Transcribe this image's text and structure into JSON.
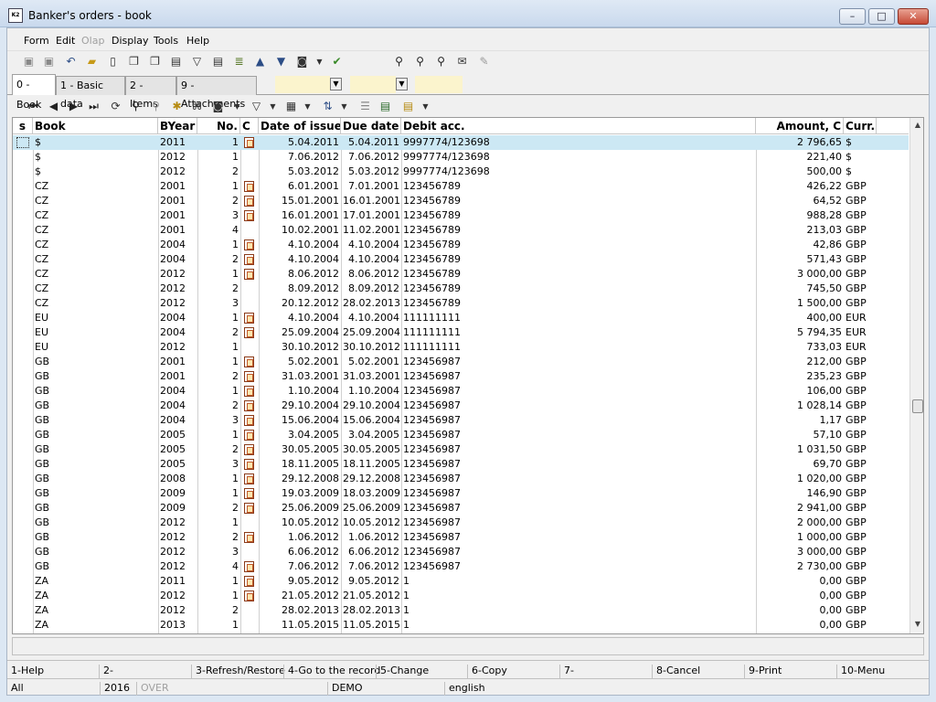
{
  "window": {
    "title": "Banker's orders - book",
    "app_badge": "K2",
    "minimize": "–",
    "maximize": "□",
    "close": "✕"
  },
  "menu": [
    "Form",
    "Edit",
    "Olap",
    "Display",
    "Tools",
    "Help"
  ],
  "tabs": [
    "0 - Book",
    "1 - Basic data",
    "2 - Items",
    "9 - Attachments"
  ],
  "columns": {
    "s": "s",
    "book": "Book",
    "byear": "BYear",
    "no": "No.",
    "c": "C",
    "issue": "Date of issue",
    "due": "Due date",
    "debit": "Debit acc.",
    "amount": "Amount, C",
    "curr": "Curr."
  },
  "rows": [
    {
      "book": "$",
      "byear": "2011",
      "no": "1",
      "c": true,
      "issue": "5.04.2011",
      "due": "5.04.2011",
      "debit": "9997774/123698",
      "amount": "2 796,65",
      "curr": "$"
    },
    {
      "book": "$",
      "byear": "2012",
      "no": "1",
      "c": false,
      "issue": "7.06.2012",
      "due": "7.06.2012",
      "debit": "9997774/123698",
      "amount": "221,40",
      "curr": "$"
    },
    {
      "book": "$",
      "byear": "2012",
      "no": "2",
      "c": false,
      "issue": "5.03.2012",
      "due": "5.03.2012",
      "debit": "9997774/123698",
      "amount": "500,00",
      "curr": "$"
    },
    {
      "book": "CZ",
      "byear": "2001",
      "no": "1",
      "c": true,
      "issue": "6.01.2001",
      "due": "7.01.2001",
      "debit": "123456789",
      "amount": "426,22",
      "curr": "GBP"
    },
    {
      "book": "CZ",
      "byear": "2001",
      "no": "2",
      "c": true,
      "issue": "15.01.2001",
      "due": "16.01.2001",
      "debit": "123456789",
      "amount": "64,52",
      "curr": "GBP"
    },
    {
      "book": "CZ",
      "byear": "2001",
      "no": "3",
      "c": true,
      "issue": "16.01.2001",
      "due": "17.01.2001",
      "debit": "123456789",
      "amount": "988,28",
      "curr": "GBP"
    },
    {
      "book": "CZ",
      "byear": "2001",
      "no": "4",
      "c": false,
      "issue": "10.02.2001",
      "due": "11.02.2001",
      "debit": "123456789",
      "amount": "213,03",
      "curr": "GBP"
    },
    {
      "book": "CZ",
      "byear": "2004",
      "no": "1",
      "c": true,
      "issue": "4.10.2004",
      "due": "4.10.2004",
      "debit": "123456789",
      "amount": "42,86",
      "curr": "GBP"
    },
    {
      "book": "CZ",
      "byear": "2004",
      "no": "2",
      "c": true,
      "issue": "4.10.2004",
      "due": "4.10.2004",
      "debit": "123456789",
      "amount": "571,43",
      "curr": "GBP"
    },
    {
      "book": "CZ",
      "byear": "2012",
      "no": "1",
      "c": true,
      "issue": "8.06.2012",
      "due": "8.06.2012",
      "debit": "123456789",
      "amount": "3 000,00",
      "curr": "GBP"
    },
    {
      "book": "CZ",
      "byear": "2012",
      "no": "2",
      "c": false,
      "issue": "8.09.2012",
      "due": "8.09.2012",
      "debit": "123456789",
      "amount": "745,50",
      "curr": "GBP"
    },
    {
      "book": "CZ",
      "byear": "2012",
      "no": "3",
      "c": false,
      "issue": "20.12.2012",
      "due": "28.02.2013",
      "debit": "123456789",
      "amount": "1 500,00",
      "curr": "GBP"
    },
    {
      "book": "EU",
      "byear": "2004",
      "no": "1",
      "c": true,
      "issue": "4.10.2004",
      "due": "4.10.2004",
      "debit": "111111111",
      "amount": "400,00",
      "curr": "EUR"
    },
    {
      "book": "EU",
      "byear": "2004",
      "no": "2",
      "c": true,
      "issue": "25.09.2004",
      "due": "25.09.2004",
      "debit": "111111111",
      "amount": "5 794,35",
      "curr": "EUR"
    },
    {
      "book": "EU",
      "byear": "2012",
      "no": "1",
      "c": false,
      "issue": "30.10.2012",
      "due": "30.10.2012",
      "debit": "111111111",
      "amount": "733,03",
      "curr": "EUR"
    },
    {
      "book": "GB",
      "byear": "2001",
      "no": "1",
      "c": true,
      "issue": "5.02.2001",
      "due": "5.02.2001",
      "debit": "123456987",
      "amount": "212,00",
      "curr": "GBP"
    },
    {
      "book": "GB",
      "byear": "2001",
      "no": "2",
      "c": true,
      "issue": "31.03.2001",
      "due": "31.03.2001",
      "debit": "123456987",
      "amount": "235,23",
      "curr": "GBP"
    },
    {
      "book": "GB",
      "byear": "2004",
      "no": "1",
      "c": true,
      "issue": "1.10.2004",
      "due": "1.10.2004",
      "debit": "123456987",
      "amount": "106,00",
      "curr": "GBP"
    },
    {
      "book": "GB",
      "byear": "2004",
      "no": "2",
      "c": true,
      "issue": "29.10.2004",
      "due": "29.10.2004",
      "debit": "123456987",
      "amount": "1 028,14",
      "curr": "GBP"
    },
    {
      "book": "GB",
      "byear": "2004",
      "no": "3",
      "c": true,
      "issue": "15.06.2004",
      "due": "15.06.2004",
      "debit": "123456987",
      "amount": "1,17",
      "curr": "GBP"
    },
    {
      "book": "GB",
      "byear": "2005",
      "no": "1",
      "c": true,
      "issue": "3.04.2005",
      "due": "3.04.2005",
      "debit": "123456987",
      "amount": "57,10",
      "curr": "GBP"
    },
    {
      "book": "GB",
      "byear": "2005",
      "no": "2",
      "c": true,
      "issue": "30.05.2005",
      "due": "30.05.2005",
      "debit": "123456987",
      "amount": "1 031,50",
      "curr": "GBP"
    },
    {
      "book": "GB",
      "byear": "2005",
      "no": "3",
      "c": true,
      "issue": "18.11.2005",
      "due": "18.11.2005",
      "debit": "123456987",
      "amount": "69,70",
      "curr": "GBP"
    },
    {
      "book": "GB",
      "byear": "2008",
      "no": "1",
      "c": true,
      "issue": "29.12.2008",
      "due": "29.12.2008",
      "debit": "123456987",
      "amount": "1 020,00",
      "curr": "GBP"
    },
    {
      "book": "GB",
      "byear": "2009",
      "no": "1",
      "c": true,
      "issue": "19.03.2009",
      "due": "18.03.2009",
      "debit": "123456987",
      "amount": "146,90",
      "curr": "GBP"
    },
    {
      "book": "GB",
      "byear": "2009",
      "no": "2",
      "c": true,
      "issue": "25.06.2009",
      "due": "25.06.2009",
      "debit": "123456987",
      "amount": "2 941,00",
      "curr": "GBP"
    },
    {
      "book": "GB",
      "byear": "2012",
      "no": "1",
      "c": false,
      "issue": "10.05.2012",
      "due": "10.05.2012",
      "debit": "123456987",
      "amount": "2 000,00",
      "curr": "GBP"
    },
    {
      "book": "GB",
      "byear": "2012",
      "no": "2",
      "c": true,
      "issue": "1.06.2012",
      "due": "1.06.2012",
      "debit": "123456987",
      "amount": "1 000,00",
      "curr": "GBP"
    },
    {
      "book": "GB",
      "byear": "2012",
      "no": "3",
      "c": false,
      "issue": "6.06.2012",
      "due": "6.06.2012",
      "debit": "123456987",
      "amount": "3 000,00",
      "curr": "GBP"
    },
    {
      "book": "GB",
      "byear": "2012",
      "no": "4",
      "c": true,
      "issue": "7.06.2012",
      "due": "7.06.2012",
      "debit": "123456987",
      "amount": "2 730,00",
      "curr": "GBP"
    },
    {
      "book": "ZA",
      "byear": "2011",
      "no": "1",
      "c": true,
      "issue": "9.05.2012",
      "due": "9.05.2012",
      "debit": "1",
      "amount": "0,00",
      "curr": "GBP"
    },
    {
      "book": "ZA",
      "byear": "2012",
      "no": "1",
      "c": true,
      "issue": "21.05.2012",
      "due": "21.05.2012",
      "debit": "1",
      "amount": "0,00",
      "curr": "GBP"
    },
    {
      "book": "ZA",
      "byear": "2012",
      "no": "2",
      "c": false,
      "issue": "28.02.2013",
      "due": "28.02.2013",
      "debit": "1",
      "amount": "0,00",
      "curr": "GBP"
    },
    {
      "book": "ZA",
      "byear": "2013",
      "no": "1",
      "c": false,
      "issue": "11.05.2015",
      "due": "11.05.2015",
      "debit": "1",
      "amount": "0,00",
      "curr": "GBP"
    }
  ],
  "function_keys": [
    "1-Help",
    "2-",
    "3-Refresh/Restore",
    "4-Go to the record",
    "5-Change",
    "6-Copy",
    "7-",
    "8-Cancel",
    "9-Print",
    "10-Menu"
  ],
  "status": {
    "filter": "All",
    "year": "2016",
    "mode": "OVER",
    "database": "DEMO",
    "language": "english"
  },
  "colors": {
    "title_gradient": "#c9d9ed",
    "selected_row": "#cce8f4",
    "tab_field": "#fbf4cd",
    "close_button": "#c64a36"
  }
}
